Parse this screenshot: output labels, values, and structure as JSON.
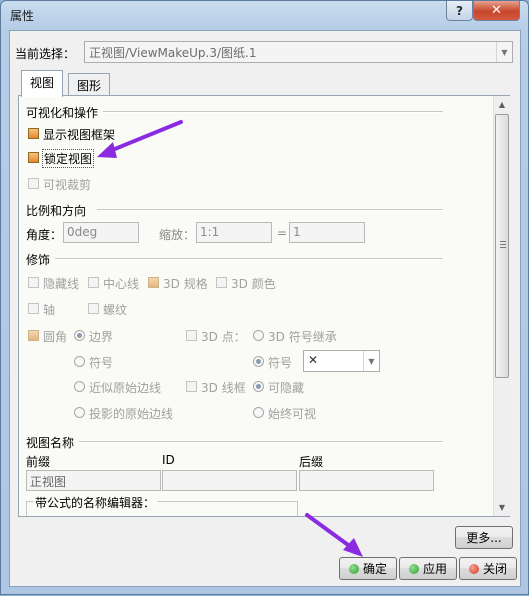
{
  "window": {
    "title": "属性",
    "help_glyph": "?",
    "close_glyph": "✕"
  },
  "current_selection": {
    "label": "当前选择：",
    "value": "正视图/ViewMakeUp.3/图纸.1"
  },
  "tabs": [
    {
      "label": "视图",
      "active": true
    },
    {
      "label": "图形",
      "active": false
    }
  ],
  "visualization": {
    "title": "可视化和操作",
    "show_frame": {
      "label": "显示视图框架",
      "checked": true
    },
    "lock_view": {
      "label": "锁定视图",
      "checked": true
    },
    "visual_clipping": {
      "label": "可视裁剪",
      "checked": false
    }
  },
  "scale": {
    "title": "比例和方向",
    "angle_label": "角度：",
    "angle_value": "0deg",
    "scale_label": "缩放：",
    "scale_value": "1:1",
    "equals": "=",
    "equals_value": "1"
  },
  "dressup": {
    "title": "修饰",
    "hidden_lines": "隐藏线",
    "center_lines": "中心线",
    "thread_3d_spec": "3D 规格",
    "color_3d": "3D 颜色",
    "axis": "轴",
    "thread": "螺纹",
    "fillet": "圆角",
    "boundary": "边界",
    "symbol": "符号",
    "approx_original_edges": "近似原始边线",
    "projected_original_edges": "投影的原始边线",
    "points_3d": "3D 点：",
    "symbol_inheritance_3d": "3D 符号继承",
    "symbol2": "符号",
    "symbol_value": "✕",
    "wireframe_3d": "3D 线框",
    "can_hide": "可隐藏",
    "always_visible": "始终可视"
  },
  "view_name": {
    "title": "视图名称",
    "prefix_label": "前缀",
    "id_label": "ID",
    "suffix_label": "后缀",
    "prefix_value": "正视图",
    "id_value": "",
    "suffix_value": "",
    "formula_editor": "带公式的名称编辑器："
  },
  "buttons": {
    "more": "更多...",
    "ok": "确定",
    "apply": "应用",
    "close": "关闭"
  },
  "colors": {
    "ok_dot": "#2e9e2e",
    "apply_dot": "#2e9e2e",
    "close_dot": "#d23a2a",
    "annotation_arrow": "#8a2be2"
  }
}
